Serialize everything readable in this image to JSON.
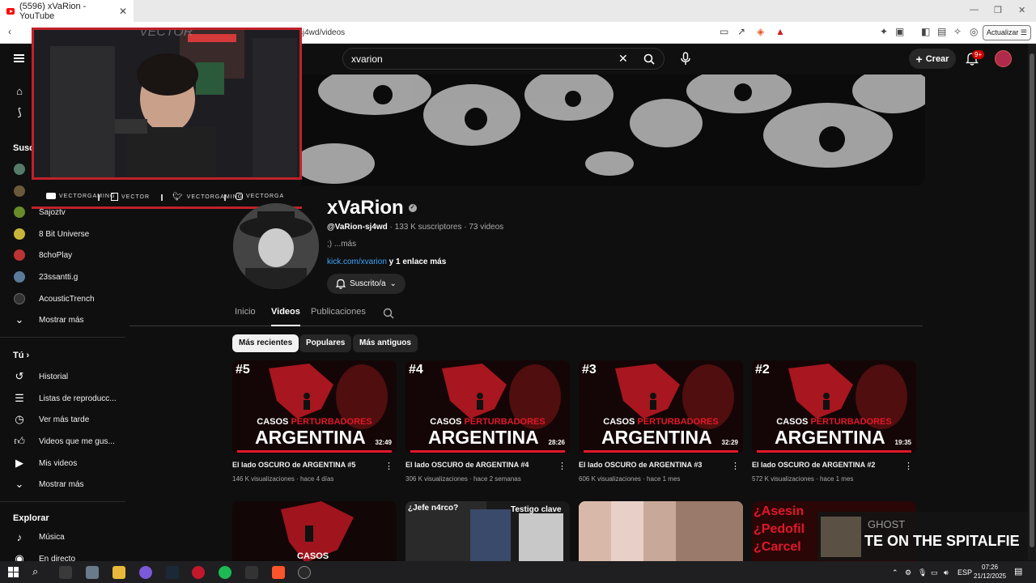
{
  "browser": {
    "tab_title": "(5596) xVaRion - YouTube",
    "url": "n-sj4wd/videos",
    "update_label": "Actualizar"
  },
  "header": {
    "search_value": "xvarion",
    "create_label": "Crear",
    "notif_count": "9+"
  },
  "sidebar": {
    "subs_heading": "Susc",
    "subscriptions": [
      {
        "label": "Sajoztv",
        "color": "#6b8a2a"
      },
      {
        "label": "8 Bit Universe",
        "color": "#c9b43a"
      },
      {
        "label": "8choPlay",
        "color": "#b33"
      },
      {
        "label": "23ssantti.g",
        "color": "#5a7a9a"
      },
      {
        "label": "AcousticTrench",
        "color": "#333"
      }
    ],
    "show_more_1": "Mostrar más",
    "you_heading": "Tú",
    "you_items": [
      {
        "label": "Historial",
        "icon": "history-icon"
      },
      {
        "label": "Listas de reproducc...",
        "icon": "playlists-icon"
      },
      {
        "label": "Ver más tarde",
        "icon": "clock-icon"
      },
      {
        "label": "Videos que me gus...",
        "icon": "thumbs-up-icon"
      },
      {
        "label": "Mis videos",
        "icon": "my-videos-icon"
      }
    ],
    "show_more_2": "Mostrar más",
    "explore_heading": "Explorar",
    "explore_items": [
      {
        "label": "Música",
        "icon": "music-icon"
      },
      {
        "label": "En directo",
        "icon": "live-icon"
      }
    ]
  },
  "webcam": {
    "watermark": "VECTOR",
    "socials": [
      {
        "label": "VECTORGAMING",
        "icon": "youtube-icon"
      },
      {
        "label": "VECTOR",
        "icon": "twitch-icon"
      },
      {
        "label": "VECTORGAMING",
        "icon": "twitter-icon"
      },
      {
        "label": "VECTORGA",
        "icon": "instagram-icon"
      }
    ]
  },
  "channel": {
    "name": "xVaRion",
    "handle": "@VaRion-sj4wd",
    "stats": " · 133 K suscriptores · 73 videos",
    "description": ";) ...más",
    "link": "kick.com/xvarion",
    "link_more": " y 1 enlace más",
    "subscribe_label": "Suscrito/a"
  },
  "tabs": [
    {
      "label": "Inicio",
      "active": false
    },
    {
      "label": "Videos",
      "active": true
    },
    {
      "label": "Publicaciones",
      "active": false
    }
  ],
  "chips": [
    {
      "label": "Más recientes",
      "active": true
    },
    {
      "label": "Populares",
      "active": false
    },
    {
      "label": "Más antiguos",
      "active": false
    }
  ],
  "videos": [
    {
      "rank": "#5",
      "casos": "CASOS ",
      "casos_red": "PERTURBADORES",
      "big": "ARGENTINA",
      "duration": "32:49",
      "title": "El lado OSCURO de ARGENTINA #5",
      "meta": "146 K visualizaciones · hace 4 días"
    },
    {
      "rank": "#4",
      "casos": "CASOS ",
      "casos_red": "PERTURBADORES",
      "big": "ARGENTINA",
      "duration": "28:26",
      "title": "El lado OSCURO de ARGENTINA #4",
      "meta": "306 K visualizaciones · hace 2 semanas"
    },
    {
      "rank": "#3",
      "casos": "CASOS ",
      "casos_red": "PERTURBADORES",
      "big": "ARGENTINA",
      "duration": "32:29",
      "title": "El lado OSCURO de ARGENTINA #3",
      "meta": "606 K visualizaciones · hace 1 mes"
    },
    {
      "rank": "#2",
      "casos": "CASOS ",
      "casos_red": "PERTURBADORES",
      "big": "ARGENTINA",
      "duration": "19:35",
      "title": "El lado OSCURO de ARGENTINA #2",
      "meta": "572 K visualizaciones · hace 1 mes"
    }
  ],
  "bottom_row": {
    "thumb1_text": "CASOS",
    "thumb2_text_a": "¿Jefe n4rco?",
    "thumb2_text_b": "Testigo clave",
    "thumb4_text_a": "¿Asesin",
    "thumb4_text_b": "¿Pedofil",
    "thumb4_text_c": "¿Carcel"
  },
  "music_overlay": {
    "artist": "GHOST",
    "song": "TE ON THE SPITALFIE"
  },
  "taskbar": {
    "lang": "ESP",
    "time": "07:26",
    "date": "21/12/2025"
  }
}
